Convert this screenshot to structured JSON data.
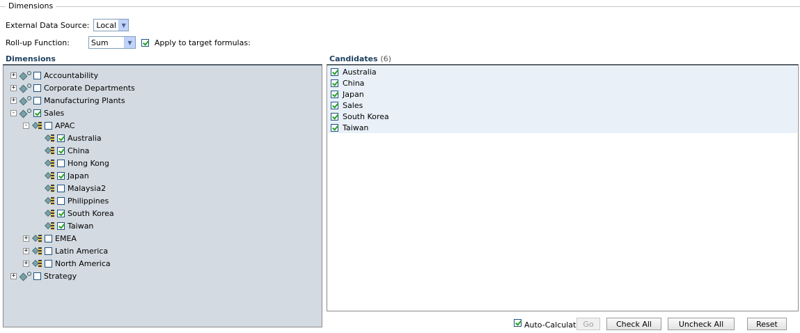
{
  "fieldset": {
    "legend": "Dimensions"
  },
  "external_source": {
    "label": "External Data Source:",
    "value": "Local"
  },
  "rollup": {
    "label": "Roll-up Function:",
    "value": "Sum",
    "apply_label": "Apply to target formulas:",
    "apply_checked": true
  },
  "left_panel": {
    "title": "Dimensions"
  },
  "right_panel": {
    "title": "Candidates",
    "count": "(6)"
  },
  "tree": [
    {
      "label": "Accountability",
      "level": 0,
      "toggle": "+",
      "icon": "dimension",
      "checked": false
    },
    {
      "label": "Corporate Departments",
      "level": 0,
      "toggle": "+",
      "icon": "dimension",
      "checked": false
    },
    {
      "label": "Manufacturing Plants",
      "level": 0,
      "toggle": "+",
      "icon": "dimension",
      "checked": false
    },
    {
      "label": "Sales",
      "level": 0,
      "toggle": "-",
      "icon": "dimension",
      "checked": true
    },
    {
      "label": "APAC",
      "level": 1,
      "toggle": "-",
      "icon": "member",
      "checked": false
    },
    {
      "label": "Australia",
      "level": 2,
      "toggle": "",
      "icon": "member",
      "checked": true
    },
    {
      "label": "China",
      "level": 2,
      "toggle": "",
      "icon": "member",
      "checked": true
    },
    {
      "label": "Hong Kong",
      "level": 2,
      "toggle": "",
      "icon": "member",
      "checked": false
    },
    {
      "label": "Japan",
      "level": 2,
      "toggle": "",
      "icon": "member",
      "checked": true
    },
    {
      "label": "Malaysia2",
      "level": 2,
      "toggle": "",
      "icon": "member",
      "checked": false
    },
    {
      "label": "Philippines",
      "level": 2,
      "toggle": "",
      "icon": "member",
      "checked": false
    },
    {
      "label": "South Korea",
      "level": 2,
      "toggle": "",
      "icon": "member",
      "checked": true
    },
    {
      "label": "Taiwan",
      "level": 2,
      "toggle": "",
      "icon": "member",
      "checked": true
    },
    {
      "label": "EMEA",
      "level": 1,
      "toggle": "+",
      "icon": "member",
      "checked": false
    },
    {
      "label": "Latin America",
      "level": 1,
      "toggle": "+",
      "icon": "member",
      "checked": false
    },
    {
      "label": "North America",
      "level": 1,
      "toggle": "+",
      "icon": "member",
      "checked": false
    },
    {
      "label": "Strategy",
      "level": 0,
      "toggle": "+",
      "icon": "dimension",
      "checked": false
    }
  ],
  "candidates": [
    "Australia",
    "China",
    "Japan",
    "Sales",
    "South Korea",
    "Taiwan"
  ],
  "footer": {
    "auto_calc_label": "Auto-Calculate",
    "auto_calc_checked": true,
    "go": "Go",
    "check_all": "Check All",
    "uncheck_all": "Uncheck All",
    "reset": "Reset"
  }
}
